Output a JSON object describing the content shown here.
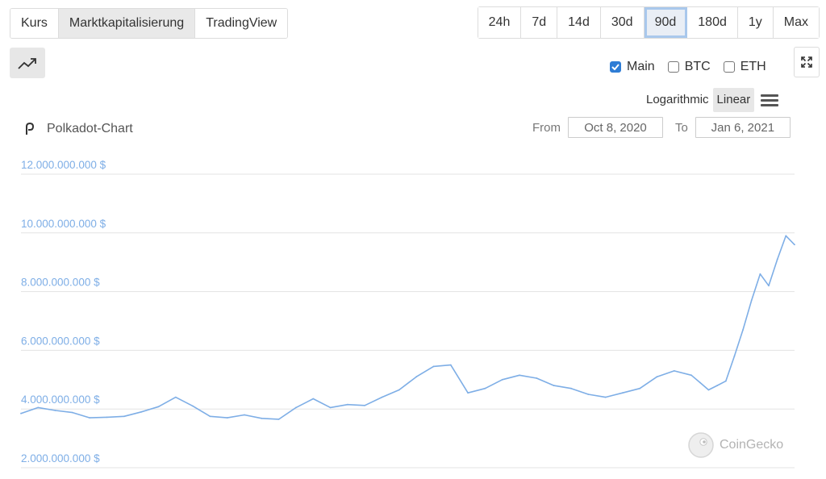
{
  "tabs": [
    {
      "label": "Kurs",
      "active": false
    },
    {
      "label": "Marktkapitalisierung",
      "active": true
    },
    {
      "label": "TradingView",
      "active": false
    }
  ],
  "ranges": [
    {
      "label": "24h",
      "active": false
    },
    {
      "label": "7d",
      "active": false
    },
    {
      "label": "14d",
      "active": false
    },
    {
      "label": "30d",
      "active": false
    },
    {
      "label": "90d",
      "active": true
    },
    {
      "label": "180d",
      "active": false
    },
    {
      "label": "1y",
      "active": false
    },
    {
      "label": "Max",
      "active": false
    }
  ],
  "compare": {
    "main_label": "Main",
    "main_checked": true,
    "btc_label": "BTC",
    "btc_checked": false,
    "eth_label": "ETH",
    "eth_checked": false
  },
  "scale": {
    "log_label": "Logarithmic",
    "linear_label": "Linear",
    "active": "Linear"
  },
  "date_range": {
    "from_label": "From",
    "from_value": "Oct 8, 2020",
    "to_label": "To",
    "to_value": "Jan 6, 2021"
  },
  "watermark": "CoinGecko",
  "colors": {
    "line": "#7eaee6",
    "accent": "#2f7dd5"
  },
  "chart_data": {
    "type": "line",
    "title": "Polkadot-Chart",
    "xlabel": "",
    "ylabel": "",
    "ylim": [
      2000000000,
      12000000000
    ],
    "yticks": [
      2000000000,
      4000000000,
      6000000000,
      8000000000,
      10000000000,
      12000000000
    ],
    "ytick_labels": [
      "2.000.000.000 $",
      "4.000.000.000 $",
      "6.000.000.000 $",
      "8.000.000.000 $",
      "10.000.000.000 $",
      "12.000.000.000 $"
    ],
    "grid": true,
    "legend": "none",
    "series": [
      {
        "x": [
          "2020-10-08",
          "2020-10-10",
          "2020-10-12",
          "2020-10-14",
          "2020-10-16",
          "2020-10-18",
          "2020-10-20",
          "2020-10-22",
          "2020-10-24",
          "2020-10-26",
          "2020-10-28",
          "2020-10-30",
          "2020-11-01",
          "2020-11-03",
          "2020-11-05",
          "2020-11-07",
          "2020-11-09",
          "2020-11-11",
          "2020-11-13",
          "2020-11-15",
          "2020-11-17",
          "2020-11-19",
          "2020-11-21",
          "2020-11-23",
          "2020-11-25",
          "2020-11-27",
          "2020-11-29",
          "2020-12-01",
          "2020-12-03",
          "2020-12-05",
          "2020-12-07",
          "2020-12-09",
          "2020-12-11",
          "2020-12-13",
          "2020-12-15",
          "2020-12-17",
          "2020-12-19",
          "2020-12-21",
          "2020-12-23",
          "2020-12-25",
          "2020-12-26",
          "2020-12-27",
          "2020-12-28",
          "2020-12-29",
          "2020-12-30",
          "2020-12-31",
          "2021-01-01",
          "2021-01-02",
          "2021-01-03",
          "2021-01-04",
          "2021-01-05",
          "2021-01-06"
        ],
        "values": [
          3850000000,
          4050000000,
          3950000000,
          3880000000,
          3700000000,
          3720000000,
          3750000000,
          3900000000,
          4080000000,
          4400000000,
          4100000000,
          3750000000,
          3700000000,
          3800000000,
          3680000000,
          3650000000,
          4050000000,
          4350000000,
          4050000000,
          4150000000,
          4120000000,
          4400000000,
          4650000000,
          5100000000,
          5450000000,
          5500000000,
          4550000000,
          4700000000,
          5000000000,
          5150000000,
          5050000000,
          4800000000,
          4700000000,
          4500000000,
          4400000000,
          4550000000,
          4700000000,
          5100000000,
          5300000000,
          5150000000,
          4900000000,
          4650000000,
          4800000000,
          4950000000,
          5800000000,
          6700000000,
          7700000000,
          8600000000,
          8200000000,
          9100000000,
          9900000000,
          9600000000
        ]
      }
    ]
  }
}
